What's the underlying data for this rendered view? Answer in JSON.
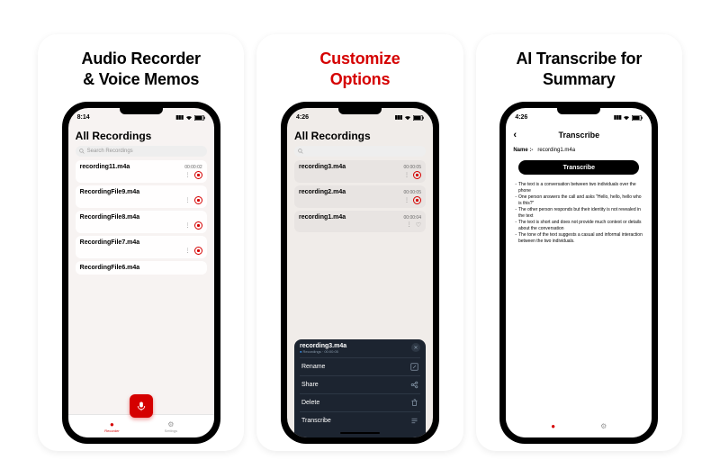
{
  "panels": [
    {
      "title_l1": "Audio Recorder",
      "title_l2": "& Voice Memos"
    },
    {
      "title_l1": "Customize",
      "title_l2": "Options"
    },
    {
      "title_l1": "AI Transcribe for",
      "title_l2": "Summary"
    }
  ],
  "screen1": {
    "time": "8:14",
    "heading": "All Recordings",
    "search_placeholder": "Search Recordings",
    "items": [
      {
        "name": "recording11.m4a",
        "dur": "00:00:02",
        "date": ""
      },
      {
        "name": "RecordingFile9.m4a",
        "dur": "",
        "date": ""
      },
      {
        "name": "RecordingFile8.m4a",
        "dur": "",
        "date": ""
      },
      {
        "name": "RecordingFile7.m4a",
        "dur": "",
        "date": ""
      },
      {
        "name": "RecordingFile6.m4a",
        "dur": "",
        "date": ""
      }
    ],
    "tabs": {
      "recorder": "Recorder",
      "settings": "Settings"
    }
  },
  "screen2": {
    "time": "4:26",
    "heading": "All Recordings",
    "items": [
      {
        "name": "recording3.m4a",
        "dur": "00:00:05"
      },
      {
        "name": "recording2.m4a",
        "dur": "00:00:05"
      },
      {
        "name": "recording1.m4a",
        "dur": "00:00:04"
      }
    ],
    "sheet": {
      "title": "recording3.m4a",
      "sub_kind": "Recordings",
      "sub_dur": "00:00:05",
      "options": [
        {
          "label": "Rename",
          "icon": "edit"
        },
        {
          "label": "Share",
          "icon": "share"
        },
        {
          "label": "Delete",
          "icon": "trash"
        },
        {
          "label": "Transcribe",
          "icon": "lines"
        }
      ]
    }
  },
  "screen3": {
    "time": "4:26",
    "title": "Transcribe",
    "name_label": "Name :-",
    "name_value": "recording1.m4a",
    "button": "Transcribe",
    "summary": [
      "The text is a conversation between two individuals over the phone",
      "One person answers the call and asks \"Hello, hello, hello who is this?\"",
      "The other person responds but their identity is not revealed in the text",
      "The text is short and does not provide much context or details about the conversation",
      "The tone of the text suggests a casual and informal interaction between the two individuals."
    ]
  }
}
